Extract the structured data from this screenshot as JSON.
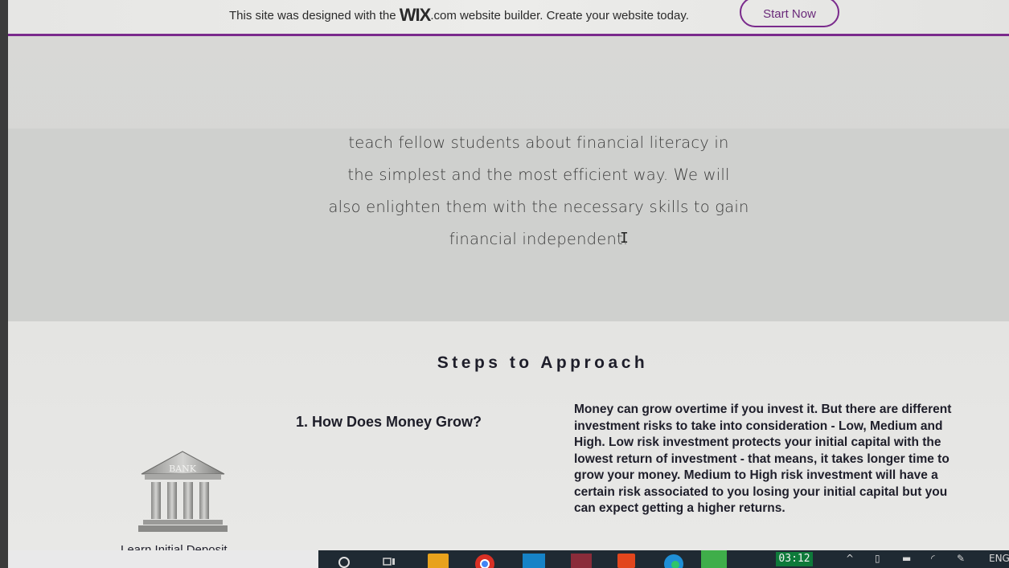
{
  "wix_banner": {
    "text_before": "This site was designed with the ",
    "brand": "WIX",
    "text_after": ".com website builder. Create your website today.",
    "button_label": "Start Now",
    "accent_color": "#7a2a8c"
  },
  "about": {
    "line1": "teach fellow students about financial literacy in",
    "line2": "the simplest and the most efficient way. We will",
    "line3": "also enlighten them with the necessary skills to gain",
    "line4": "financial independent."
  },
  "steps": {
    "title": "Steps to Approach",
    "step1_heading": "1. How Does Money Grow?",
    "step1_body": "Money can grow overtime if you invest it. But there are different investment risks to take into consideration - Low, Medium and High. Low risk investment protects your initial capital with the lowest return of investment - that means, it takes longer time to grow your money. Medium to High risk investment will have a certain risk associated to you losing your initial capital but you can expect getting a higher returns.",
    "bank_label": "BANK",
    "partial_label": "Learn Initial Deposit"
  },
  "taskbar": {
    "clock": "03:12",
    "lang": "ENG",
    "icons": [
      "cortana-icon",
      "task-view-icon",
      "file-explorer-icon",
      "chrome-icon",
      "whatsapp-icon",
      "app-icon",
      "office-icon",
      "edge-icon",
      "green-app-icon"
    ]
  }
}
